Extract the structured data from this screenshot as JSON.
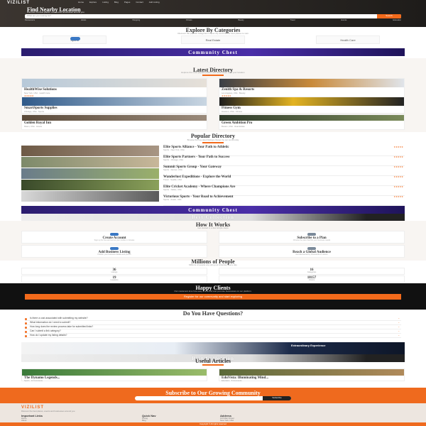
{
  "header": {
    "logo": "VIZILIST",
    "nav": [
      "Home",
      "Explore",
      "Listing",
      "Blog",
      "Pages",
      "Contact",
      "Add Listing"
    ],
    "title": "Find Nearby Location",
    "subtitle": "Discover the best places, events and businesses around you",
    "search_placeholder": "What are you looking for?",
    "search_button": "Search",
    "pills": [
      "Restaurants",
      "Hotels",
      "Shopping",
      "Fitness",
      "Beauty",
      "Travel",
      "Events",
      "Education"
    ]
  },
  "categories": {
    "title": "Explore By Categories",
    "subtitle": "Discover the popular categories in your city and find the best places to visit",
    "items": [
      "Sports",
      "Real Estate",
      "Health Care"
    ]
  },
  "banner1": {
    "text": "Community Chest"
  },
  "latest": {
    "title": "Latest Directory",
    "subtitle": "Explore the most popular places and businesses near your location",
    "cards": [
      {
        "title": "HealthWise Solutions",
        "meta": "New York, USA · Health Care",
        "rating": "★★★★★"
      },
      {
        "title": "Zenith Spa & Resorts",
        "meta": "Los Angeles, USA · Beauty",
        "rating": "★★★★★"
      },
      {
        "title": "SmartSports Supplies",
        "meta": "Chicago, USA · Sports",
        "rating": "★★★★★"
      },
      {
        "title": "Fitness Gym",
        "meta": "Houston, USA · Fitness",
        "rating": "★★★★★"
      },
      {
        "title": "Golden Royal Inn",
        "meta": "Miami, USA · Hotels",
        "rating": "★★★★★"
      },
      {
        "title": "Green Ambition Pro",
        "meta": "Boston, USA · Real Estate",
        "rating": "★★★★★"
      }
    ]
  },
  "popular": {
    "title": "Popular Directory",
    "subtitle": "Browse the top-rated listings chosen by our community",
    "rows": [
      {
        "title": "Elite Sports Alliance - Your Path to Athletic",
        "meta": "Sports · New York, USA",
        "rating": "★★★★★"
      },
      {
        "title": "Elite Sports Partners - Your Path to Success",
        "meta": "Sports · Chicago, USA",
        "rating": "★★★★★"
      },
      {
        "title": "Summit Sports Group - Your Gateway",
        "meta": "Sports · Denver, USA",
        "rating": "★★★★★"
      },
      {
        "title": "Wanderlust Expeditions - Explore the World",
        "meta": "Travel · Seattle, USA",
        "rating": "★★★★★"
      },
      {
        "title": "Elite Cricket Academy - Where Champions Are",
        "meta": "Sports · Dallas, USA",
        "rating": "★★★★★"
      },
      {
        "title": "Victorious Sports - Your Road to Achievement",
        "meta": "Sports · Austin, USA",
        "rating": "★★★★★"
      }
    ]
  },
  "banner2": {
    "text": "Community Chest"
  },
  "collection1": {
    "text": "Best Collection"
  },
  "how": {
    "title": "How It Works",
    "subtitle": "Get started in a few simple steps",
    "steps": [
      {
        "title": "Create Account",
        "desc": "Sign up for free and set up your profile in minutes"
      },
      {
        "title": "Subscribe to a Plan",
        "desc": "Choose the plan that fits your business needs"
      },
      {
        "title": "Add Business Listing",
        "desc": "Publish your business details and photos"
      },
      {
        "title": "Reach a Global Audience",
        "desc": "Get discovered by thousands of visitors"
      }
    ]
  },
  "stats": {
    "title": "Millions of People",
    "subtitle": "Millions of people are using our directory every day",
    "items": [
      {
        "num": "36",
        "label": "Listings"
      },
      {
        "num": "16",
        "label": "Categories"
      },
      {
        "num": "19",
        "label": "Locations"
      },
      {
        "num": "18157",
        "label": "Visitors"
      }
    ]
  },
  "clients": {
    "title": "Happy Clients",
    "text": "Our customers love how easy it is to find and promote businesses on our platform.",
    "cta": "Register for our community and start exploring"
  },
  "faq": {
    "title": "Do You Have Questions?",
    "items": [
      "Is there a cost associated with submitting my website?",
      "What information do I need to submit?",
      "How long does the review process take for submitted links?",
      "Can I submit a link category?",
      "How do I update my listing details?"
    ]
  },
  "collection2": {
    "text": "Best Collection",
    "tag": "Extraordinary Experience"
  },
  "articles": {
    "title": "Useful Articles",
    "posts": [
      {
        "title": "The Dynamo Legends...",
        "meta": "Sports · 12 Comments"
      },
      {
        "title": "EduVista: Illuminating Mind...",
        "meta": "Education · 8 Comments"
      }
    ]
  },
  "subscribe": {
    "title": "Subscribe to Our Growing Community",
    "button": "Subscribe"
  },
  "footer": {
    "logo": "VIZILIST",
    "about": "Discover the best places, events and businesses around you.",
    "cols": [
      {
        "title": "Important Links",
        "items": [
          "Home",
          "About",
          "Contact"
        ]
      },
      {
        "title": "Quick Nav",
        "items": [
          "Listing",
          "Blog",
          "Pages"
        ]
      },
      {
        "title": "Address",
        "items": [
          "123 Main Street",
          "New York, USA"
        ]
      }
    ],
    "copyright": "Copyright © All rights reserved"
  },
  "colors": {
    "accent": "#f26a1b",
    "banner": "#2b1d6f",
    "dark": "#111111"
  }
}
